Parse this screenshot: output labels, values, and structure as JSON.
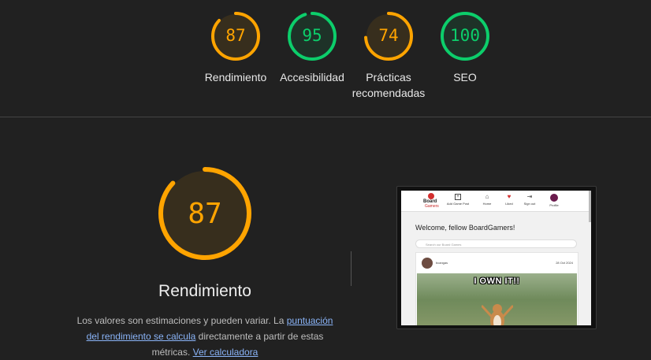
{
  "colors": {
    "orange": "#ffa400",
    "green": "#0cce6b",
    "background": "#212121",
    "link": "#8ab4f8"
  },
  "top_gauges": [
    {
      "score": "87",
      "score_value": 87,
      "label": "Rendimiento",
      "status": "average"
    },
    {
      "score": "95",
      "score_value": 95,
      "label": "Accesibilidad",
      "status": "pass"
    },
    {
      "score": "74",
      "score_value": 74,
      "label": "Prácticas recomendadas",
      "status": "average"
    },
    {
      "score": "100",
      "score_value": 100,
      "label": "SEO",
      "status": "pass"
    }
  ],
  "main": {
    "score": "87",
    "score_value": 87,
    "title": "Rendimiento",
    "desc_part1": "Los valores son estimaciones y pueden variar. La ",
    "desc_link1": "puntuación del rendimiento se calcula",
    "desc_part2": " directamente a partir de estas métricas. ",
    "desc_link2": "Ver calculadora"
  },
  "thumbnail": {
    "logo_line1": "Board",
    "logo_line2": "Gamers",
    "nav": [
      {
        "label": "Add Game Post",
        "icon": "plus-box-icon"
      },
      {
        "label": "Home",
        "icon": "home-icon"
      },
      {
        "label": "Liked",
        "icon": "heart-icon"
      },
      {
        "label": "Sign out",
        "icon": "sign-out-icon"
      },
      {
        "label": "Profile",
        "icon": "avatar-icon"
      }
    ],
    "welcome": "Welcome, fellow BoardGamers!",
    "search_placeholder": "Search our Board Games",
    "post_user": "bcangas",
    "post_date": "28 Oct 2024",
    "post_image_text": "I OWN IT!!"
  }
}
